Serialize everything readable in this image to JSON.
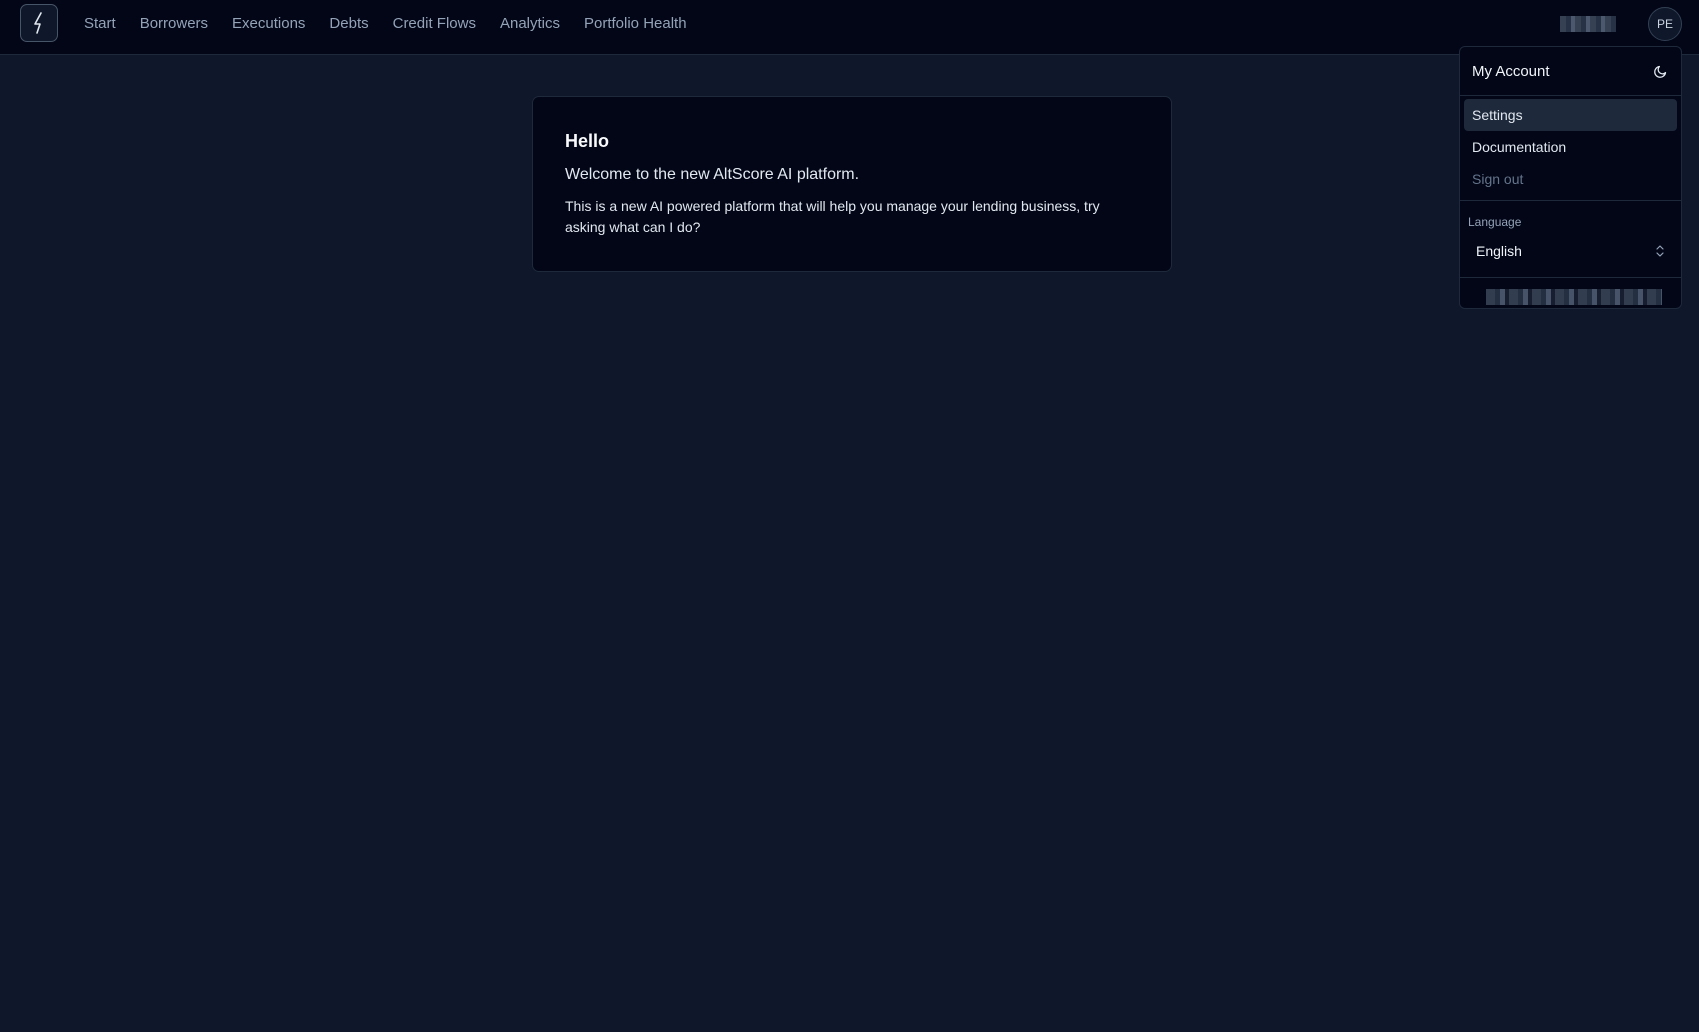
{
  "brand": {
    "logo_icon": "lightning-bolt-icon"
  },
  "nav": {
    "items": [
      {
        "label": "Start"
      },
      {
        "label": "Borrowers"
      },
      {
        "label": "Executions"
      },
      {
        "label": "Debts"
      },
      {
        "label": "Credit Flows"
      },
      {
        "label": "Analytics"
      },
      {
        "label": "Portfolio Health"
      }
    ]
  },
  "user": {
    "avatar_initials": "PE"
  },
  "welcome_card": {
    "title": "Hello",
    "subtitle": "Welcome to the new AltScore AI platform.",
    "body": "This is a new AI powered platform that will help you manage your lending business, try asking what can I do?"
  },
  "account_menu": {
    "header": "My Account",
    "theme_icon": "moon-icon",
    "items": [
      {
        "label": "Settings"
      },
      {
        "label": "Documentation"
      },
      {
        "label": "Sign out"
      }
    ],
    "language_label": "Language",
    "language_value": "English",
    "language_icon": "chevron-up-down-icon"
  },
  "colors": {
    "background": "#0f172a",
    "surface": "#020617",
    "border": "#1e293b",
    "text": "#e2e8f0",
    "muted_text": "#94a3b8"
  }
}
